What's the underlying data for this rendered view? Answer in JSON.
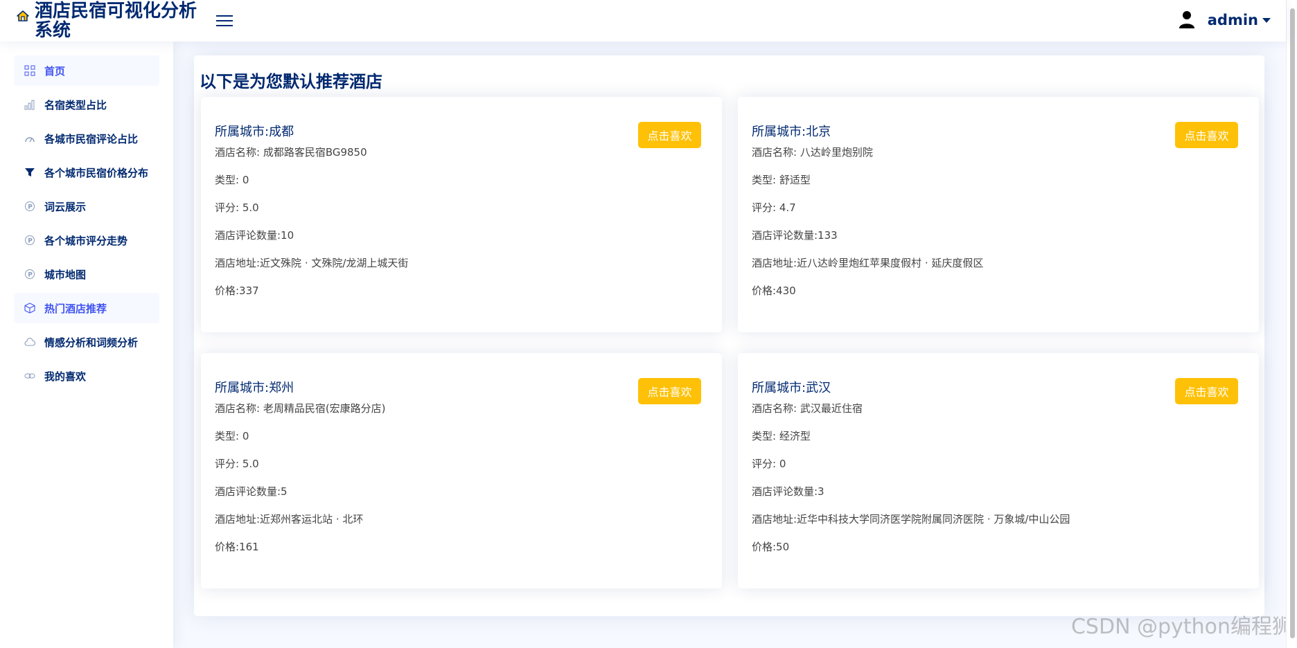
{
  "header": {
    "title": "酒店民宿可视化分析系统",
    "user": "admin"
  },
  "sidebar": {
    "items": [
      {
        "label": "首页",
        "icon": "grid-icon"
      },
      {
        "label": "名宿类型占比",
        "icon": "bar-chart-icon"
      },
      {
        "label": "各城市民宿评论占比",
        "icon": "gauge-icon"
      },
      {
        "label": "各个城市民宿价格分布",
        "icon": "funnel-icon"
      },
      {
        "label": "词云展示",
        "icon": "p-circle-icon"
      },
      {
        "label": "各个城市评分走势",
        "icon": "p-circle-icon"
      },
      {
        "label": "城市地图",
        "icon": "p-circle-icon"
      },
      {
        "label": "热门酒店推荐",
        "icon": "box-icon"
      },
      {
        "label": "情感分析和词频分析",
        "icon": "cloud-icon"
      },
      {
        "label": "我的喜欢",
        "icon": "link-icon"
      }
    ]
  },
  "main": {
    "title": "以下是为您默认推荐酒店",
    "like_label": "点击喜欢",
    "hotels": [
      {
        "city": "所属城市:成都",
        "name": "酒店名称: 成都路客民宿BG9850",
        "type": "类型: 0",
        "score": "评分: 5.0",
        "reviews": "酒店评论数量:10",
        "address": "酒店地址:近文殊院 · 文殊院/龙湖上城天街",
        "price": "价格:337"
      },
      {
        "city": "所属城市:北京",
        "name": "酒店名称: 八达岭里炮别院",
        "type": "类型: 舒适型",
        "score": "评分: 4.7",
        "reviews": "酒店评论数量:133",
        "address": "酒店地址:近八达岭里炮红苹果度假村 · 延庆度假区",
        "price": "价格:430"
      },
      {
        "city": "所属城市:郑州",
        "name": "酒店名称: 老周精品民宿(宏康路分店)",
        "type": "类型: 0",
        "score": "评分: 5.0",
        "reviews": "酒店评论数量:5",
        "address": "酒店地址:近郑州客运北站 · 北环",
        "price": "价格:161"
      },
      {
        "city": "所属城市:武汉",
        "name": "酒店名称: 武汉最近住宿",
        "type": "类型: 经济型",
        "score": "评分: 0",
        "reviews": "酒店评论数量:3",
        "address": "酒店地址:近华中科技大学同济医学院附属同济医院 · 万象城/中山公园",
        "price": "价格:50"
      }
    ]
  },
  "watermark": "CSDN @python编程狮",
  "colors": {
    "primary": "#012970",
    "accent": "#4154f1",
    "button": "#ffc107"
  }
}
